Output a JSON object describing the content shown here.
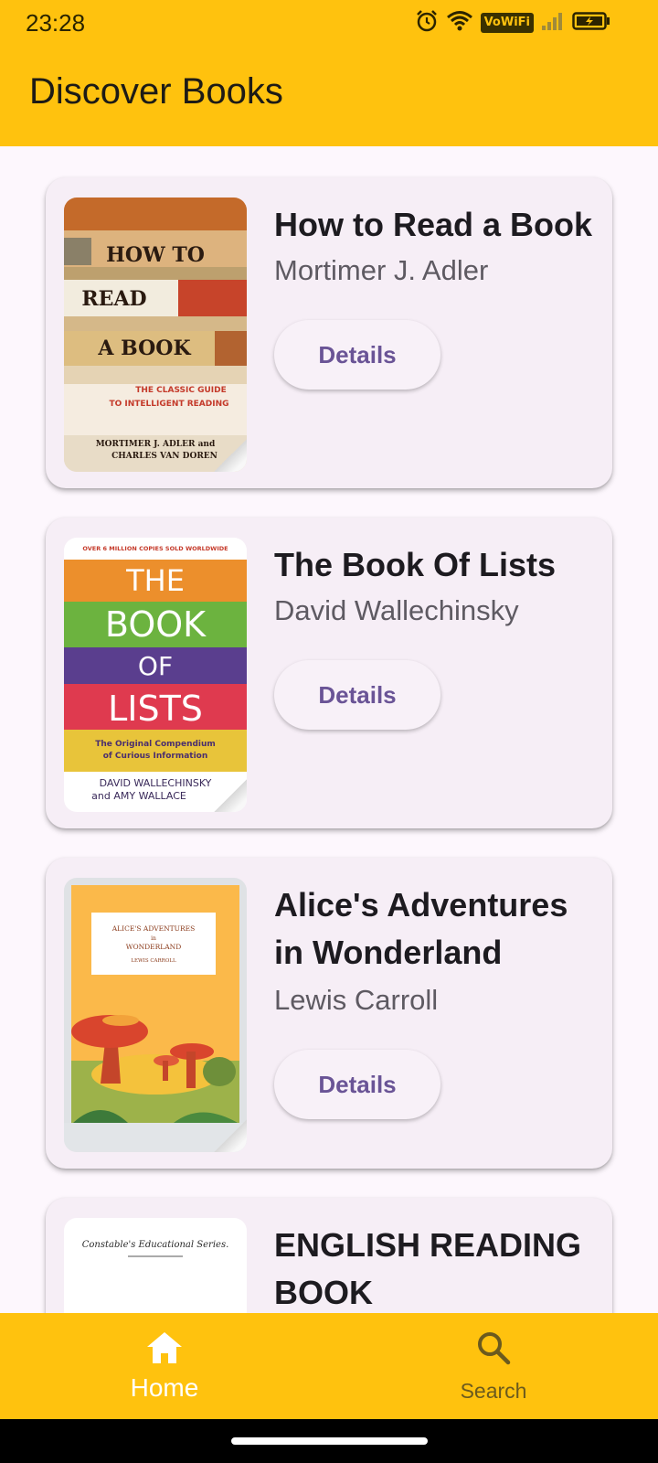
{
  "status_bar": {
    "time": "23:28",
    "vowifi": "VoWiFi",
    "icons": [
      "alarm-icon",
      "wifi-icon",
      "signal-icon",
      "battery-charging-icon"
    ]
  },
  "app_bar": {
    "title": "Discover Books"
  },
  "books": [
    {
      "title": "How to Read a Book",
      "author": "Mortimer J. Adler",
      "button": "Details"
    },
    {
      "title": "The Book Of Lists",
      "author": "David Wallechinsky",
      "button": "Details"
    },
    {
      "title": "Alice's Adventures in Wonderland",
      "author": "Lewis Carroll",
      "button": "Details"
    },
    {
      "title": "ENGLISH READING BOOK",
      "author": "",
      "button": ""
    }
  ],
  "covers": {
    "book1": {
      "l1": "HOW TO",
      "l2": "READ",
      "l3": "A BOOK",
      "sub1": "THE CLASSIC GUIDE",
      "sub2": "TO INTELLIGENT READING",
      "auth1": "MORTIMER J. ADLER and",
      "auth2": "CHARLES VAN DOREN"
    },
    "book2": {
      "top": "OVER 6 MILLION COPIES SOLD WORLDWIDE",
      "l1": "THE",
      "l2": "BOOK",
      "l3": "OF",
      "l4": "LISTS",
      "sub1": "The Original Compendium",
      "sub2": "of Curious Information",
      "auth1": "DAVID WALLECHINSKY",
      "auth2": "and AMY WALLACE"
    },
    "book3": {
      "l1": "ALICE'S ADVENTURES",
      "l2": "in",
      "l3": "WONDERLAND",
      "l4": "LEWIS CARROLL"
    },
    "book4": {
      "l1": "Constable's Educational Series."
    }
  },
  "bottom_nav": {
    "items": [
      {
        "label": "Home",
        "icon": "home-icon",
        "active": true
      },
      {
        "label": "Search",
        "icon": "search-icon",
        "active": false
      }
    ]
  },
  "colors": {
    "accent": "#ffc20e",
    "card": "#f6eef6",
    "button_text": "#6a5496"
  }
}
